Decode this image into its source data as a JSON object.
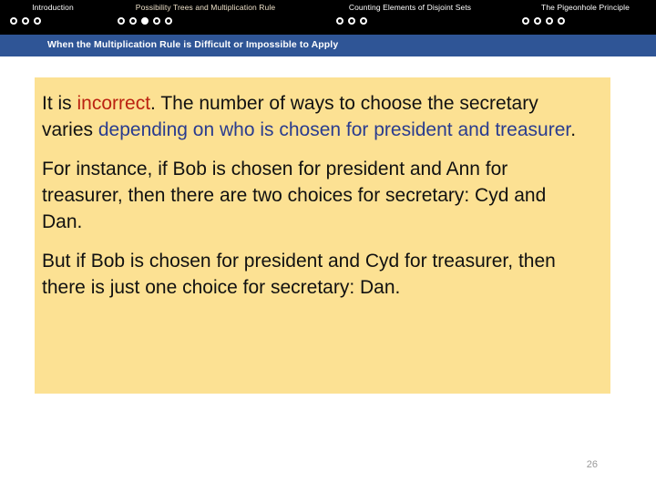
{
  "nav": {
    "sections": [
      {
        "label": "Introduction",
        "dots": [
          false,
          false,
          false
        ],
        "active": false
      },
      {
        "label": "Possibility Trees and Multiplication Rule",
        "dots": [
          false,
          false,
          true,
          false,
          false
        ],
        "active": true
      },
      {
        "label": "Counting Elements of Disjoint Sets",
        "dots": [
          false,
          false,
          false
        ],
        "active": false
      },
      {
        "label": "The Pigeonhole Principle",
        "dots": [
          false,
          false,
          false,
          false
        ],
        "active": false
      }
    ]
  },
  "subtitle": {
    "text": "When the Multiplication Rule is Difficult or Impossible to Apply"
  },
  "content": {
    "paragraph_1": {
      "part_a": "It is ",
      "highlight_red": "incorrect",
      "part_b": ". The number of ways to choose the secretary varies ",
      "highlight_blue": "depending on who is chosen for president and treasurer",
      "part_c": "."
    },
    "paragraph_2": "For instance, if Bob is chosen for president and Ann for treasurer, then there are two choices for secretary: Cyd and Dan.",
    "paragraph_3": "But if Bob is chosen for president and Cyd for treasurer, then there is just one choice for secretary: Dan."
  },
  "footer": {
    "page_number": "26"
  },
  "colors": {
    "nav_background": "#000000",
    "nav_text": "#ffffff",
    "nav_text_active": "#ede0c8",
    "subtitle_background": "#2f5596",
    "subtitle_text": "#ffffff",
    "card_background": "#fce193",
    "body_text": "#111111",
    "accent_red": "#bb2211",
    "accent_blue": "#2a3c8f",
    "page_number": "#9a9a9a"
  }
}
